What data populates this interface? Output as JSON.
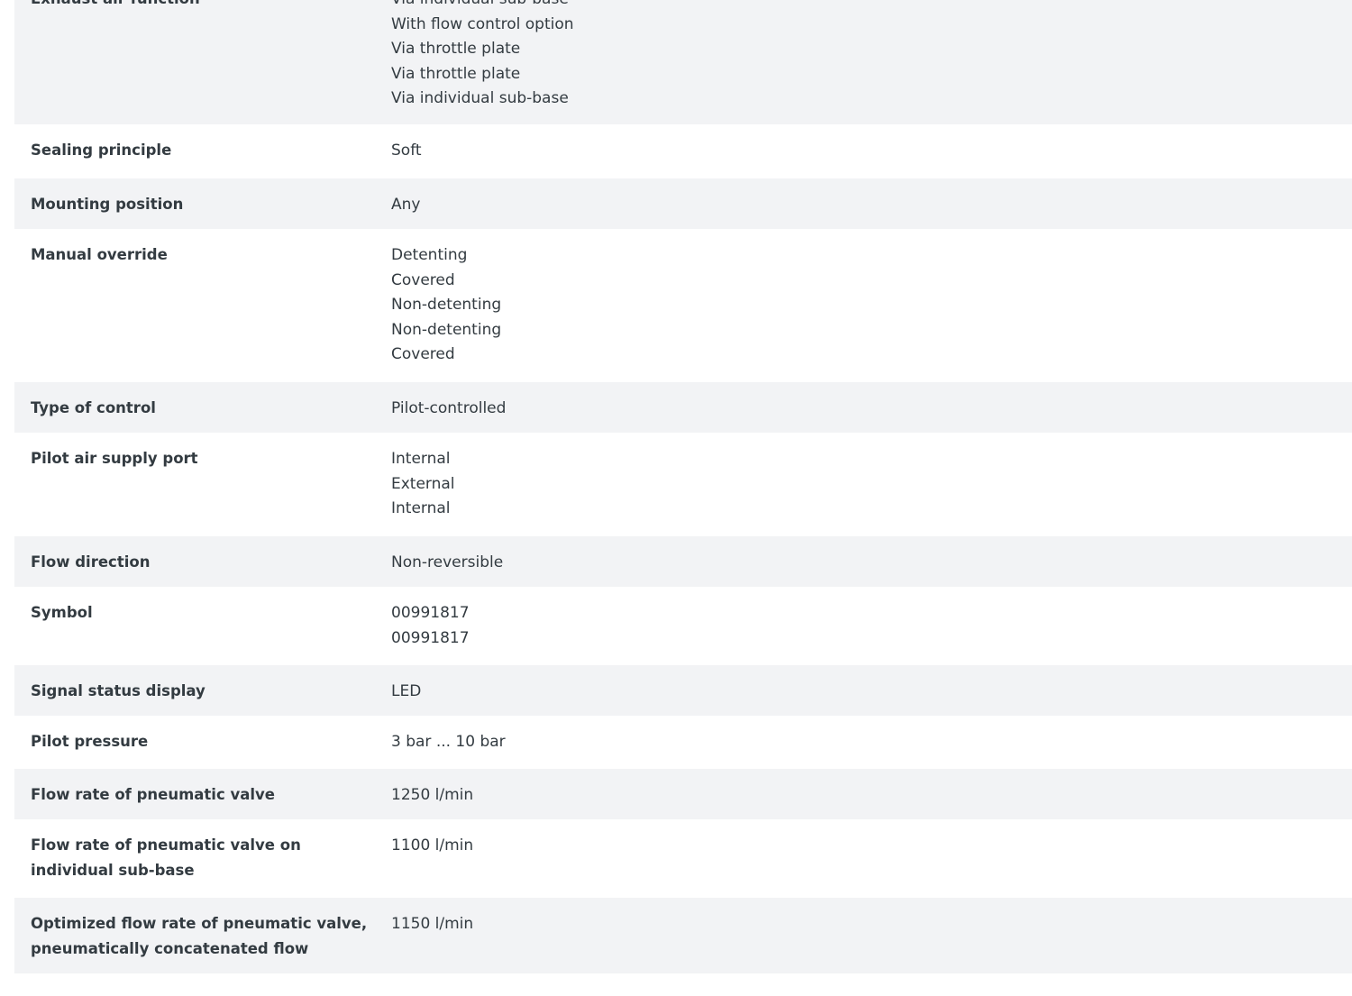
{
  "specs": [
    {
      "label": "Exhaust air function",
      "values": [
        "Via individual sub-base",
        "With flow control option",
        "Via throttle plate",
        "Via throttle plate",
        "Via individual sub-base"
      ]
    },
    {
      "label": "Sealing principle",
      "values": [
        "Soft"
      ]
    },
    {
      "label": "Mounting position",
      "values": [
        "Any"
      ]
    },
    {
      "label": "Manual override",
      "values": [
        "Detenting",
        "Covered",
        "Non-detenting",
        "Non-detenting",
        "Covered"
      ]
    },
    {
      "label": "Type of control",
      "values": [
        "Pilot-controlled"
      ]
    },
    {
      "label": "Pilot air supply port",
      "values": [
        "Internal",
        "External",
        "Internal"
      ]
    },
    {
      "label": "Flow direction",
      "values": [
        "Non-reversible"
      ]
    },
    {
      "label": "Symbol",
      "values": [
        "00991817",
        "00991817"
      ]
    },
    {
      "label": "Signal status display",
      "values": [
        "LED"
      ]
    },
    {
      "label": "Pilot pressure",
      "values": [
        "3 bar ... 10 bar"
      ]
    },
    {
      "label": "Flow rate of pneumatic valve",
      "values": [
        "1250 l/min"
      ]
    },
    {
      "label": "Flow rate of pneumatic valve on individual sub-base",
      "values": [
        "1100 l/min"
      ]
    },
    {
      "label": "Optimized flow rate of pneumatic valve, pneumatically concatenated flow",
      "values": [
        "1150 l/min"
      ]
    }
  ]
}
